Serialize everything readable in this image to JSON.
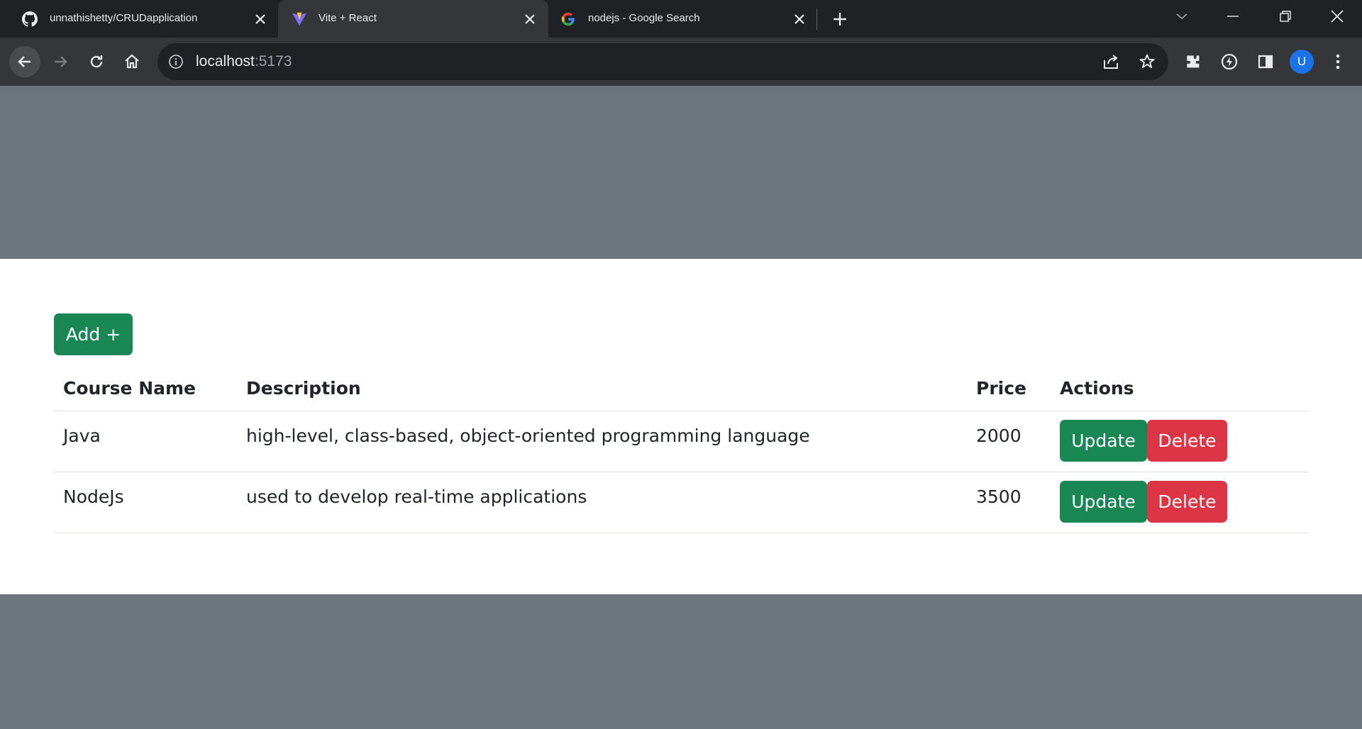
{
  "browser": {
    "tabs": [
      {
        "title": "unnathishetty/CRUDapplication",
        "favicon": "github-icon",
        "active": false
      },
      {
        "title": "Vite + React",
        "favicon": "vite-icon",
        "active": true
      },
      {
        "title": "nodejs - Google Search",
        "favicon": "google-icon",
        "active": false
      }
    ],
    "url_host": "localhost",
    "url_port": ":5173",
    "profile_initial": "U",
    "colors": {
      "accent": "#1a73e8",
      "tab_bg": "#202124",
      "toolbar_bg": "#35363a"
    }
  },
  "app": {
    "add_button_label": "Add +",
    "table": {
      "headers": [
        "Course Name",
        "Description",
        "Price",
        "Actions"
      ],
      "rows": [
        {
          "name": "Java",
          "description": "high-level, class-based, object-oriented programming language",
          "price": "2000"
        },
        {
          "name": "NodeJs",
          "description": "used to develop real-time applications",
          "price": "3500"
        }
      ]
    },
    "update_label": "Update",
    "delete_label": "Delete",
    "colors": {
      "success": "#198754",
      "danger": "#dc3545",
      "backdrop": "#6c757d"
    }
  }
}
